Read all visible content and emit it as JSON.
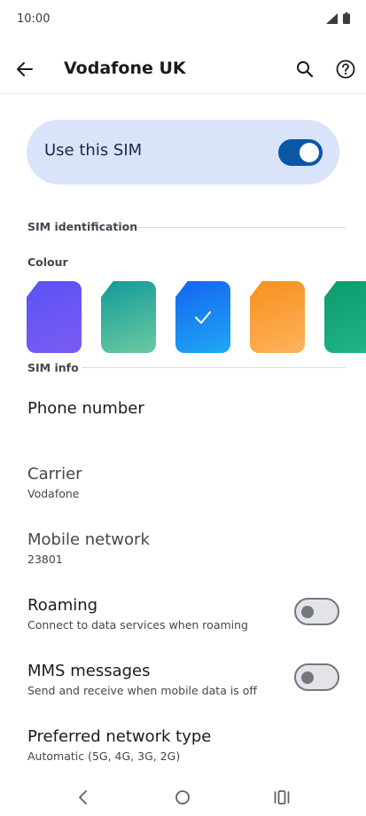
{
  "status": {
    "time": "10:00"
  },
  "app_bar": {
    "title": "Vodafone UK"
  },
  "sim_toggle": {
    "label": "Use this SIM",
    "on": true
  },
  "sections": {
    "identification": "SIM identification",
    "colour_label": "Colour",
    "info": "SIM info"
  },
  "colours": [
    {
      "name": "purple",
      "from": "#5b52f5",
      "to": "#7a5cf2",
      "selected": false
    },
    {
      "name": "teal",
      "from": "#129a9a",
      "to": "#6ccaa0",
      "selected": false
    },
    {
      "name": "blue",
      "from": "#1565f0",
      "to": "#1ea8f5",
      "selected": true
    },
    {
      "name": "orange",
      "from": "#f7901e",
      "to": "#fdb35c",
      "selected": false
    },
    {
      "name": "green",
      "from": "#0d9a6f",
      "to": "#22b48a",
      "selected": false
    }
  ],
  "items": {
    "phone_number": {
      "title": "Phone number"
    },
    "carrier": {
      "title": "Carrier",
      "value": "Vodafone"
    },
    "mobile_network": {
      "title": "Mobile network",
      "value": "23801"
    },
    "roaming": {
      "title": "Roaming",
      "subtitle": "Connect to data services when roaming",
      "on": false
    },
    "mms": {
      "title": "MMS messages",
      "subtitle": "Send and receive when mobile data is off",
      "on": false
    },
    "preferred_network": {
      "title": "Preferred network type",
      "value": "Automatic (5G, 4G, 3G, 2G)"
    }
  },
  "accent": "#0b57a4"
}
